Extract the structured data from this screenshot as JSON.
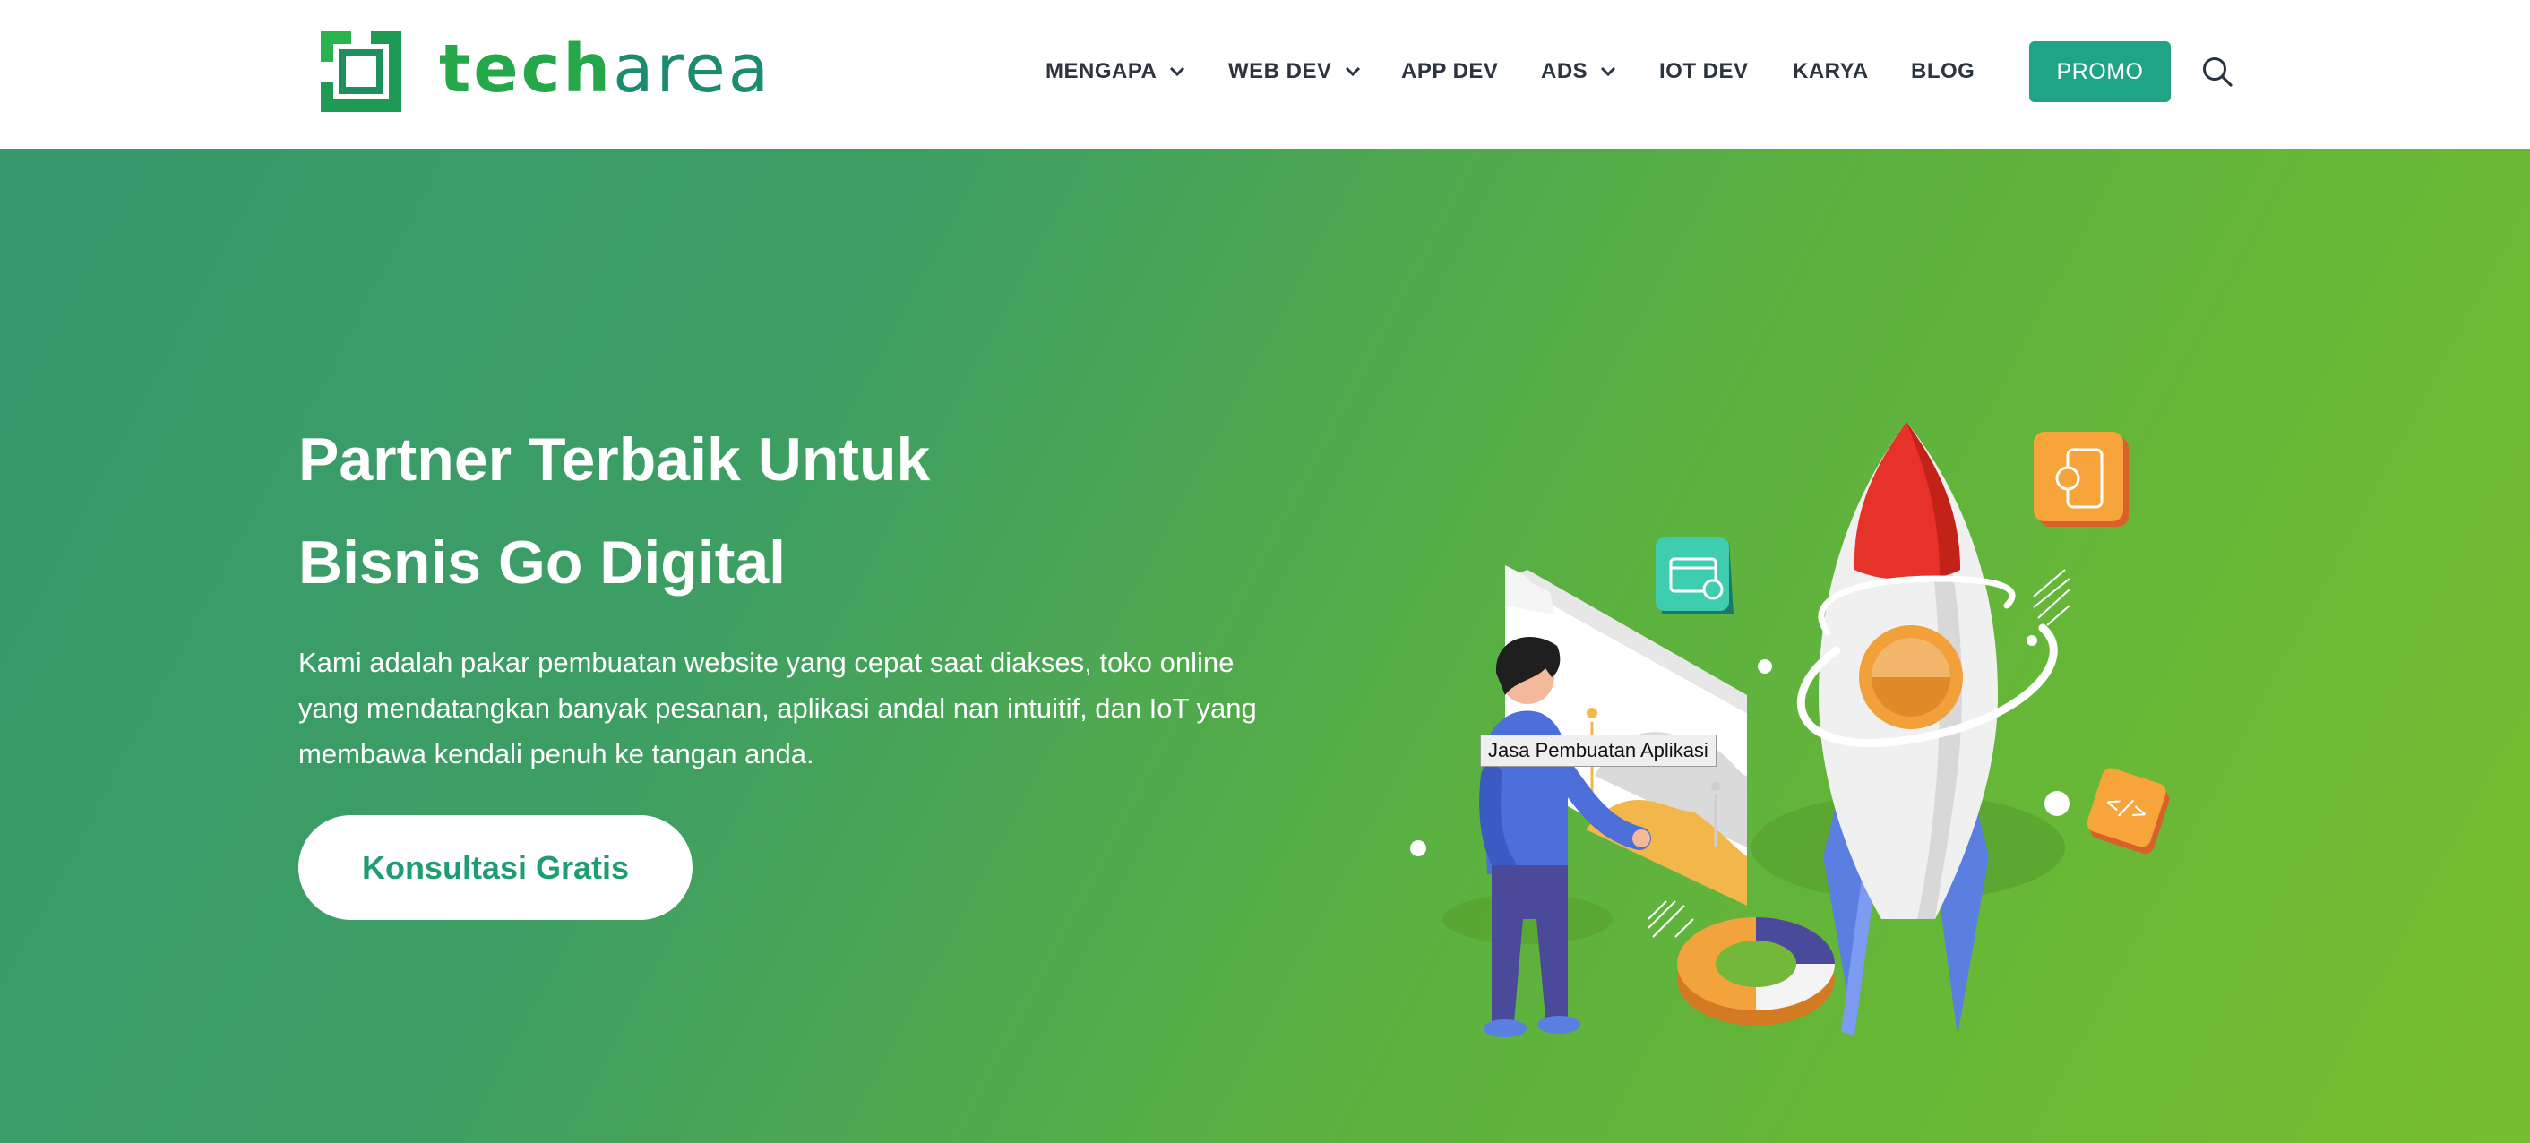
{
  "brand": {
    "name_part1": "tech",
    "name_part2": "area"
  },
  "nav": {
    "items": [
      {
        "label": "MENGAPA",
        "has_dropdown": true
      },
      {
        "label": "WEB DEV",
        "has_dropdown": true
      },
      {
        "label": "APP DEV",
        "has_dropdown": false
      },
      {
        "label": "ADS",
        "has_dropdown": true
      },
      {
        "label": "IOT DEV",
        "has_dropdown": false
      },
      {
        "label": "KARYA",
        "has_dropdown": false
      },
      {
        "label": "BLOG",
        "has_dropdown": false
      }
    ],
    "promo_label": "PROMO"
  },
  "hero": {
    "title_line1": "Partner Terbaik Untuk",
    "title_line2": "Bisnis Go Digital",
    "description": "Kami adalah pakar pembuatan website yang cepat saat diakses, toko online yang mendatangkan banyak pesanan, aplikasi andal nan intuitif, dan IoT yang membawa kendali penuh ke tangan anda.",
    "cta_label": "Konsultasi Gratis",
    "image_tooltip": "Jasa Pembuatan Aplikasi"
  },
  "colors": {
    "brand_green": "#24a84a",
    "brand_teal": "#1c8c6e",
    "promo": "#1fa586",
    "hero_start": "#36996d",
    "hero_end": "#76be2e",
    "nav_text": "#2c3440"
  },
  "icons": [
    "logo-mark",
    "chevron-down-icon",
    "search-icon"
  ]
}
